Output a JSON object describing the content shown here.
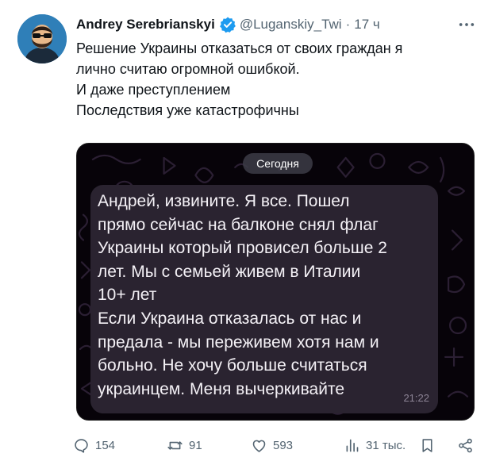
{
  "tweet": {
    "author_name": "Andrey Serebrianskyi",
    "handle": "@Luganskiy_Twi",
    "separator": "·",
    "time": "17 ч",
    "more_icon": "more-dots-icon",
    "text_lines": [
      "Решение Украины отказаться от своих граждан я",
      "лично считаю огромной ошибкой.",
      "И даже преступлением",
      "Последствия уже катастрофичны"
    ]
  },
  "media": {
    "date_pill": "Сегодня",
    "message_lines": [
      "Андрей, извините. Я все. Пошел",
      "прямо сейчас на балконе снял флаг",
      "Украины который провисел больше 2",
      "лет. Мы с семьей живем в Италии",
      "10+ лет",
      "Если Украина отказалась от нас и",
      "предала - мы переживем хотя нам и",
      "больно. Не хочу больше считаться",
      "украинцем. Меня вычеркивайте"
    ],
    "message_time": "21:22"
  },
  "actions": {
    "replies": "154",
    "reposts": "91",
    "likes": "593",
    "views": "31 тыс."
  },
  "colors": {
    "verified_blue": "#1d9bf0",
    "secondary_text": "#536471",
    "bubble_bg": "#2a2330",
    "media_bg": "#070309"
  }
}
